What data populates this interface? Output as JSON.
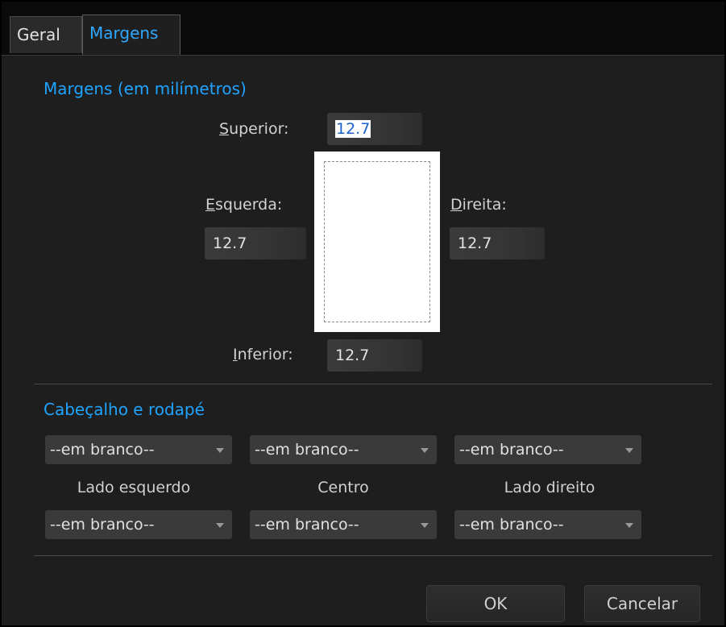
{
  "tabs": [
    {
      "label": "Geral"
    },
    {
      "label": "Margens"
    }
  ],
  "margins": {
    "title": "Margens (em milímetros)",
    "top": {
      "label_key": "S",
      "label_rest": "uperior:",
      "value": "12.7"
    },
    "left": {
      "label_key": "E",
      "label_rest": "squerda:",
      "value": "12.7"
    },
    "right": {
      "label_key": "D",
      "label_rest": "ireita:",
      "value": "12.7"
    },
    "bottom": {
      "label_key": "I",
      "label_rest": "nferior:",
      "value": "12.7"
    }
  },
  "header_footer": {
    "title": "Cabeçalho e rodapé",
    "header": {
      "left": "--em branco--",
      "center": "--em branco--",
      "right": "--em branco--"
    },
    "positions": {
      "left": "Lado esquerdo",
      "center": "Centro",
      "right": "Lado direito"
    },
    "footer": {
      "left": "--em branco--",
      "center": "--em branco--",
      "right": "--em branco--"
    }
  },
  "buttons": {
    "ok": "OK",
    "cancel": "Cancelar"
  },
  "colors": {
    "accent": "#1fa4ff",
    "background": "#1e1e1e"
  }
}
